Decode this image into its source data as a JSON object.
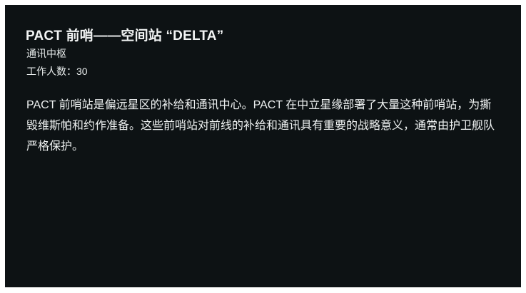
{
  "station": {
    "title": "PACT 前哨——空间站 “DELTA”",
    "type": "通讯中枢",
    "crew": "工作人数：30",
    "description": "PACT 前哨站是偏远星区的补给和通讯中心。PACT 在中立星缘部署了大量这种前哨站，为撕毁维斯帕和约作准备。这些前哨站对前线的补给和通讯具有重要的战略意义，通常由护卫舰队严格保护。"
  },
  "colors": {
    "panel_background": "#0d1214",
    "text": "#f2f4f4"
  }
}
